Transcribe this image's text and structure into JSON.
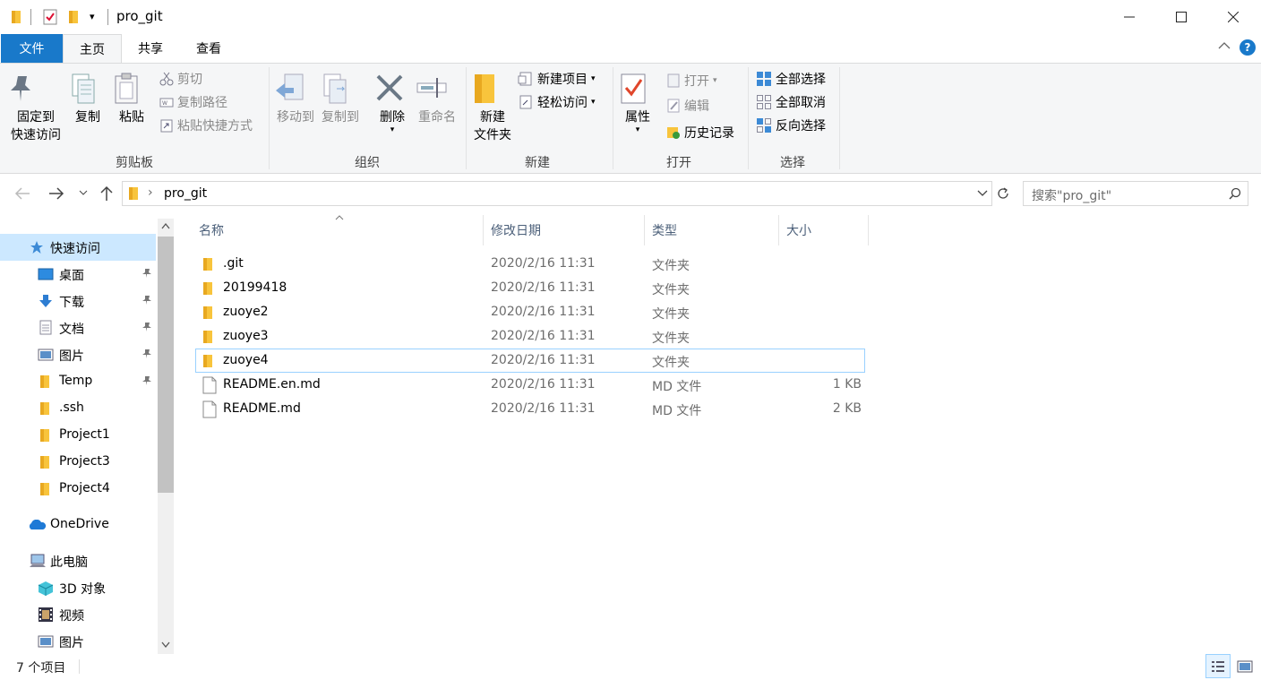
{
  "window": {
    "title": "pro_git"
  },
  "tabs": {
    "file": "文件",
    "home": "主页",
    "share": "共享",
    "view": "查看"
  },
  "ribbon": {
    "clipboard": {
      "label": "剪贴板",
      "pin": "固定到\n快速访问",
      "pin_l1": "固定到",
      "pin_l2": "快速访问",
      "copy": "复制",
      "paste": "粘贴",
      "cut": "剪切",
      "copy_path": "复制路径",
      "paste_shortcut": "粘贴快捷方式"
    },
    "organize": {
      "label": "组织",
      "move_to": "移动到",
      "copy_to": "复制到",
      "delete": "删除",
      "rename": "重命名"
    },
    "new": {
      "label": "新建",
      "new_folder_l1": "新建",
      "new_folder_l2": "文件夹",
      "new_item": "新建项目",
      "easy_access": "轻松访问"
    },
    "open": {
      "label": "打开",
      "properties": "属性",
      "open": "打开",
      "edit": "编辑",
      "history": "历史记录"
    },
    "select": {
      "label": "选择",
      "select_all": "全部选择",
      "select_none": "全部取消",
      "invert": "反向选择"
    }
  },
  "address": {
    "path": "pro_git",
    "search_placeholder": "搜索\"pro_git\""
  },
  "sidebar": {
    "quick_access": "快速访问",
    "pinned": [
      {
        "label": "桌面"
      },
      {
        "label": "下载"
      },
      {
        "label": "文档"
      },
      {
        "label": "图片"
      },
      {
        "label": "Temp"
      }
    ],
    "recent": [
      {
        "label": ".ssh"
      },
      {
        "label": "Project1"
      },
      {
        "label": "Project3"
      },
      {
        "label": "Project4"
      }
    ],
    "onedrive": "OneDrive",
    "this_pc": "此电脑",
    "pc_items": [
      {
        "label": "3D 对象"
      },
      {
        "label": "视频"
      },
      {
        "label": "图片"
      }
    ]
  },
  "columns": {
    "name": "名称",
    "date": "修改日期",
    "type": "类型",
    "size": "大小"
  },
  "files": [
    {
      "name": ".git",
      "date": "2020/2/16 11:31",
      "type": "文件夹",
      "size": "",
      "kind": "folder"
    },
    {
      "name": "20199418",
      "date": "2020/2/16 11:31",
      "type": "文件夹",
      "size": "",
      "kind": "folder"
    },
    {
      "name": "zuoye2",
      "date": "2020/2/16 11:31",
      "type": "文件夹",
      "size": "",
      "kind": "folder"
    },
    {
      "name": "zuoye3",
      "date": "2020/2/16 11:31",
      "type": "文件夹",
      "size": "",
      "kind": "folder"
    },
    {
      "name": "zuoye4",
      "date": "2020/2/16 11:31",
      "type": "文件夹",
      "size": "",
      "kind": "folder",
      "selected": true
    },
    {
      "name": "README.en.md",
      "date": "2020/2/16 11:31",
      "type": "MD 文件",
      "size": "1 KB",
      "kind": "file"
    },
    {
      "name": "README.md",
      "date": "2020/2/16 11:31",
      "type": "MD 文件",
      "size": "2 KB",
      "kind": "file"
    }
  ],
  "status": {
    "count": "7 个项目"
  },
  "colors": {
    "accent": "#1979ca",
    "folder": "#f8c43c",
    "selection_border": "#99d1ff"
  }
}
